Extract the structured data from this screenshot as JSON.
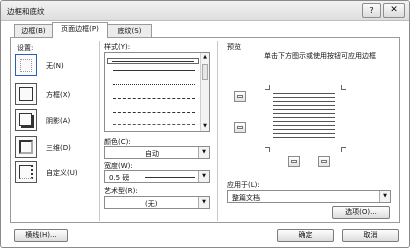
{
  "title": "边框和底纹",
  "controls": {
    "help": "?",
    "close": "✕"
  },
  "tabs": [
    {
      "label": "边框(B)"
    },
    {
      "label": "页面边框(P)"
    },
    {
      "label": "底纹(S)"
    }
  ],
  "setting": {
    "label": "设置:",
    "options": [
      {
        "label": "无(N)"
      },
      {
        "label": "方框(X)"
      },
      {
        "label": "阴影(A)"
      },
      {
        "label": "三维(D)"
      },
      {
        "label": "自定义(U)"
      }
    ]
  },
  "style": {
    "label": "样式(Y):"
  },
  "color": {
    "label": "颜色(C):",
    "value": "自动"
  },
  "width": {
    "label": "宽度(W):",
    "value": "0.5 磅"
  },
  "art": {
    "label": "艺术型(R):",
    "value": "(无)"
  },
  "preview": {
    "label": "预览",
    "hint": "单击下方图示或使用按钮可应用边框"
  },
  "apply_to": {
    "label": "应用于(L):",
    "value": "整篇文档"
  },
  "buttons": {
    "options": "选项(O)...",
    "horizontal_line": "横线(H)...",
    "ok": "确定",
    "cancel": "取消"
  }
}
